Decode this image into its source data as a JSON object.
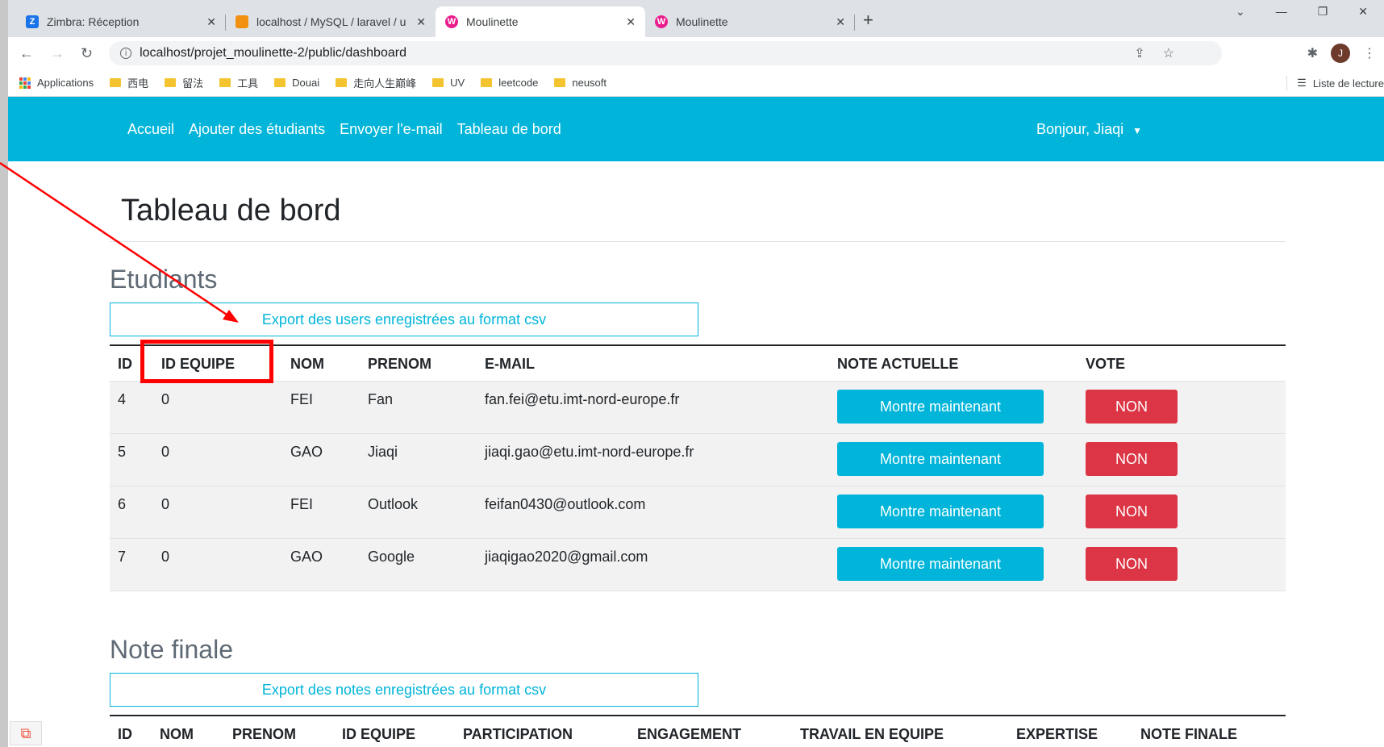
{
  "browser": {
    "tabs": [
      {
        "title": "Zimbra: Réception",
        "icon": "zimbra-icon",
        "color": "#1a73e8",
        "letter": "Z",
        "active": false
      },
      {
        "title": "localhost / MySQL / laravel / u",
        "icon": "phpmyadmin-icon",
        "color": "#f29111",
        "letter": "",
        "active": false
      },
      {
        "title": "Moulinette",
        "icon": "moulinette-icon",
        "color": "#e91e8c",
        "letter": "W",
        "active": true
      },
      {
        "title": "Moulinette",
        "icon": "moulinette-icon",
        "color": "#e91e8c",
        "letter": "W",
        "active": false
      }
    ],
    "url": "localhost/projet_moulinette-2/public/dashboard",
    "bookmarks": [
      "Applications",
      "西电",
      "留法",
      "工具",
      "Douai",
      "走向人生巅峰",
      "UV",
      "leetcode",
      "neusoft"
    ],
    "reading_list": "Liste de lecture",
    "avatar_letter": "J"
  },
  "nav": {
    "links": [
      "Accueil",
      "Ajouter des étudiants",
      "Envoyer l'e-mail",
      "Tableau de bord"
    ],
    "user": "Bonjour, Jiaqi"
  },
  "page": {
    "title": "Tableau de bord",
    "students": {
      "heading": "Etudiants",
      "export_label": "Export des users enregistrées au format csv",
      "columns": [
        "ID",
        "ID EQUIPE",
        "NOM",
        "PRENOM",
        "E-MAIL",
        "NOTE ACTUELLE",
        "VOTE"
      ],
      "rows": [
        {
          "id": "4",
          "team": "0",
          "nom": "FEI",
          "prenom": "Fan",
          "email": "fan.fei@etu.imt-nord-europe.fr",
          "note": "Montre maintenant",
          "vote": "NON"
        },
        {
          "id": "5",
          "team": "0",
          "nom": "GAO",
          "prenom": "Jiaqi",
          "email": "jiaqi.gao@etu.imt-nord-europe.fr",
          "note": "Montre maintenant",
          "vote": "NON"
        },
        {
          "id": "6",
          "team": "0",
          "nom": "FEI",
          "prenom": "Outlook",
          "email": "feifan0430@outlook.com",
          "note": "Montre maintenant",
          "vote": "NON"
        },
        {
          "id": "7",
          "team": "0",
          "nom": "GAO",
          "prenom": "Google",
          "email": "jiaqigao2020@gmail.com",
          "note": "Montre maintenant",
          "vote": "NON"
        }
      ]
    },
    "final": {
      "heading": "Note finale",
      "export_label": "Export des notes enregistrées au format csv",
      "columns": [
        "ID",
        "NOM",
        "PRENOM",
        "ID EQUIPE",
        "PARTICIPATION",
        "ENGAGEMENT",
        "TRAVAIL EN EQUIPE",
        "EXPERTISE",
        "NOTE FINALE"
      ]
    }
  },
  "colors": {
    "primary": "#00b5d9",
    "danger": "#dc3545",
    "annotation": "#ff0000"
  }
}
